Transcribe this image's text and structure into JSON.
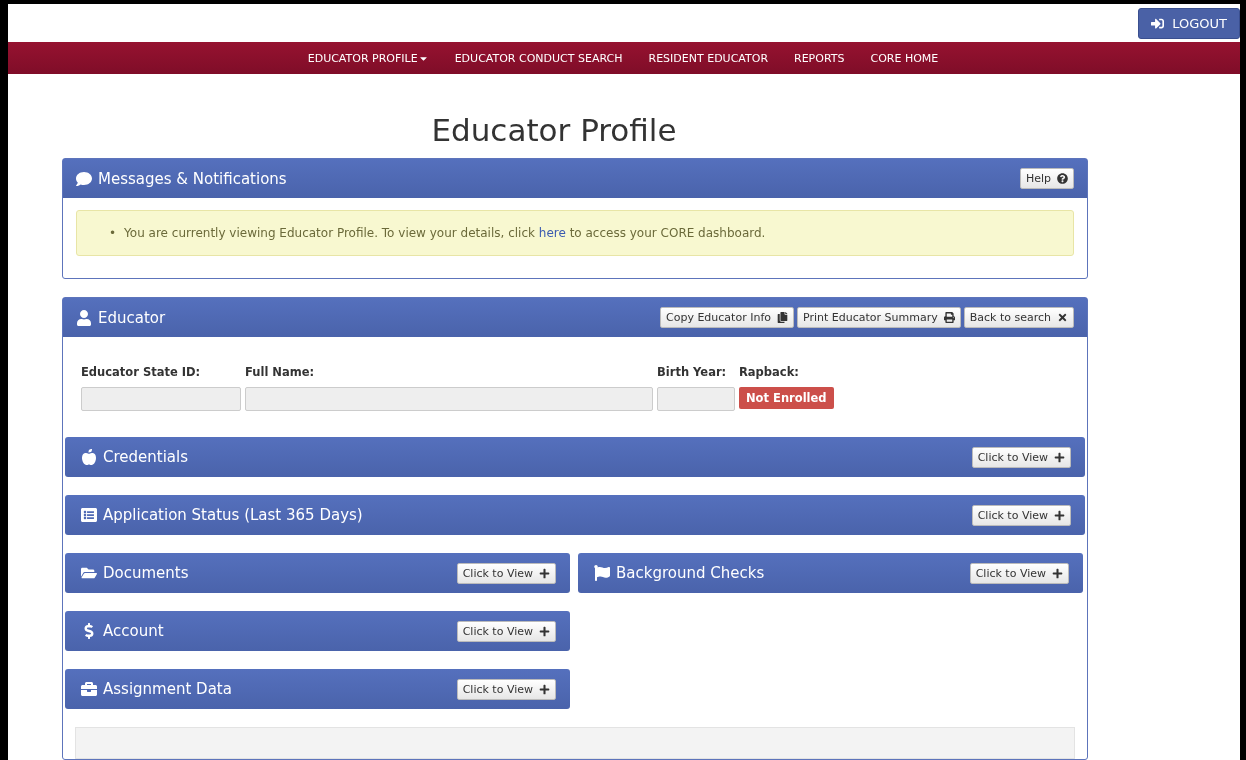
{
  "logout_button": "LOGOUT",
  "nav": [
    {
      "label": "EDUCATOR PROFILE",
      "kind": "dropdown"
    },
    {
      "label": "EDUCATOR CONDUCT SEARCH",
      "kind": "link"
    },
    {
      "label": "RESIDENT EDUCATOR",
      "kind": "link"
    },
    {
      "label": "REPORTS",
      "kind": "link"
    },
    {
      "label": "CORE HOME",
      "kind": "link"
    }
  ],
  "page_title": "Educator Profile",
  "messages_panel": {
    "title": "Messages & Notifications",
    "help_button": "Help",
    "messages": [
      {
        "bullet": "•",
        "before": "You are currently viewing Educator Profile. To view your details, click",
        "link": "here",
        "after": "to access your CORE dashboard."
      }
    ]
  },
  "educator_panel": {
    "title": "Educator",
    "buttons": [
      {
        "label": "Copy Educator Info",
        "kind": "copy"
      },
      {
        "label": "Print Educator Summary",
        "kind": "print"
      },
      {
        "label": "Back to search",
        "kind": "close"
      }
    ],
    "fields": [
      {
        "label": "Educator State ID:",
        "kind": "id"
      },
      {
        "label": "Full Name:",
        "kind": "name"
      },
      {
        "label": "Birth Year:",
        "kind": "year"
      },
      {
        "label": "Rapback:",
        "kind": "status",
        "badge": "Not Enrolled"
      }
    ],
    "section_rows": [
      [
        {
          "title": "Credentials",
          "kind": "apple",
          "button": "Click to View"
        }
      ],
      [
        {
          "title": "Application Status (Last 365 Days)",
          "kind": "list",
          "button": "Click to View"
        }
      ],
      [
        {
          "title": "Documents",
          "kind": "folder",
          "button": "Click to View"
        },
        {
          "title": "Background Checks",
          "kind": "flag",
          "button": "Click to View"
        }
      ],
      [
        {
          "title": "Account",
          "kind": "dollar",
          "button": "Click to View"
        }
      ],
      [
        {
          "title": "Assignment Data",
          "kind": "briefcase",
          "button": "Click to View"
        }
      ]
    ]
  }
}
